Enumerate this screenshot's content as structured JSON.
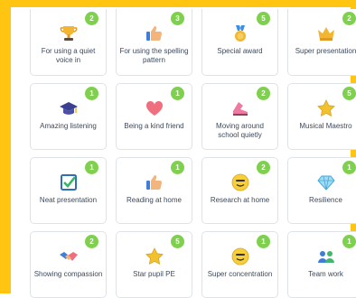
{
  "cards": [
    {
      "label": "For using a quiet voice in",
      "count": "2",
      "icon": "trophy-icon"
    },
    {
      "label": "For using the spelling pattern",
      "count": "3",
      "icon": "thumbs-up-icon"
    },
    {
      "label": "Special award",
      "count": "5",
      "icon": "medal-icon"
    },
    {
      "label": "Super presentation",
      "count": "2",
      "icon": "crown-icon"
    },
    {
      "label": "Amazing listening",
      "count": "1",
      "icon": "graduation-cap-icon"
    },
    {
      "label": "Being a kind friend",
      "count": "1",
      "icon": "heart-icon"
    },
    {
      "label": "Moving around school quietly",
      "count": "2",
      "icon": "shoe-icon"
    },
    {
      "label": "Musical Maestro",
      "count": "5",
      "icon": "star-icon"
    },
    {
      "label": "Neat presentation",
      "count": "1",
      "icon": "checkbox-icon"
    },
    {
      "label": "Reading at home",
      "count": "1",
      "icon": "thumbs-up-icon"
    },
    {
      "label": "Research at home",
      "count": "2",
      "icon": "smiley-icon"
    },
    {
      "label": "Resilience",
      "count": "1",
      "icon": "diamond-icon"
    },
    {
      "label": "Showing compassion",
      "count": "2",
      "icon": "handshake-icon"
    },
    {
      "label": "Star pupil PE",
      "count": "5",
      "icon": "star-icon"
    },
    {
      "label": "Super concentration",
      "count": "1",
      "icon": "smiley-icon"
    },
    {
      "label": "Team work",
      "count": "1",
      "icon": "team-icon"
    }
  ],
  "colors": {
    "frame": "#ffc511",
    "badge": "#7fd04f",
    "text": "#3d4a5c"
  }
}
